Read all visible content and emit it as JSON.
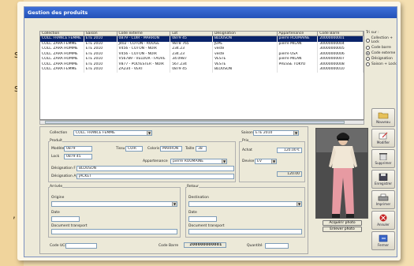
{
  "window": {
    "title": "Gestion des produits"
  },
  "list": {
    "columns": [
      "Collection",
      "Saison",
      "Code externe",
      "Lot",
      "Désignation",
      "Appartenance",
      "Code Barre"
    ],
    "rows": [
      [
        "COLL. FRANCE FEMME",
        "ETE 2010",
        "0879 - CUIR - MARRON",
        "0879 45",
        "BLOUSON",
        "pierre ROUMAINE",
        "20000000001"
      ],
      [
        "COLL. ZARA FEMME",
        "ETE 2010",
        "J402 - COTON - ROUGE",
        "9878 765",
        "JUPE",
        "pierre MILAN",
        "30000000004"
      ],
      [
        "COLL. ZARA HOMME",
        "ETE 2010",
        "V456 - COTON - NOIR",
        "234.23",
        "veste",
        "",
        "30000000005"
      ],
      [
        "COLL. ZARA HOMME",
        "ETE 2010",
        "V456 - COTON - NOIR",
        "234.23",
        "veste",
        "pierre USA",
        "30000000006"
      ],
      [
        "COLL. ZARA HOMME",
        "ETE 2010",
        "V56789 - VELOUR - FAUVE",
        "34.0987",
        "VESTE",
        "pierre MILAN",
        "30000000007"
      ],
      [
        "COLL. ZARA HOMME",
        "ETE 2010",
        "V877 - POLYESTER - NOIR",
        "567.234",
        "VESTE",
        "PRESSE TOKYO",
        "30000000008"
      ],
      [
        "COLL. ZARA FEMME",
        "ETE 2010",
        "ZA234 - VERT",
        "0879 45",
        "BLOUSON",
        "",
        "30000000010"
      ]
    ]
  },
  "sort": {
    "title": "Tri sur :",
    "options": [
      "Collection + Lock",
      "Code barre",
      "Code externe",
      "Désignation",
      "Saison + Lock"
    ],
    "selected_index": 2
  },
  "form": {
    "collection_label": "Collection",
    "collection_value": "COLL. FRANCE FEMME",
    "saison_label": "Saison",
    "saison_value": "ETE 2010",
    "produit_group": "Produit",
    "modele_label": "Modèle",
    "modele_value": "0879",
    "tissu_label": "Tissu",
    "tissu_value": "CUIR",
    "coloris_label": "Coloris",
    "coloris_value": "MARRON",
    "taille_label": "Taille",
    "taille_value": "38",
    "lock_label": "Lock",
    "lock_value": "0879 45",
    "appartenance_label": "Appartenance",
    "appartenance_value": "pierre ROUMAINE",
    "designation_f_label": "Désignation F",
    "designation_f_value": "BLOUSON",
    "designation_a_label": "Désignation A",
    "designation_a_value": "JACKET",
    "prix_group": "Prix",
    "achat_label": "Achat",
    "achat_value": "120.00 €",
    "devise_label": "Devise",
    "devise_value": "EV",
    "prix_value2": "120.00",
    "arrivee_group": "Arrivée",
    "origine_label": "Origine",
    "date_label": "Date",
    "doc_transport_label": "Document transport",
    "retour_group": "Retour",
    "destination_label": "Destination",
    "date_retour_label": "Date",
    "doc_transport_retour_label": "Document transport",
    "code_ucd_label": "Code UCD",
    "code_barre_label": "Code Barre",
    "code_barre_value": "200000000001",
    "quantite_label": "Quantité"
  },
  "photo": {
    "acquire_label": "Acquérir photo",
    "delete_label": "Enlever photo"
  },
  "toolbar": {
    "buttons": [
      "Nouveau",
      "Modifier",
      "Supprimer",
      "Enregistrer",
      "Imprimer",
      "Annuler",
      "Fermer"
    ]
  },
  "colors": {
    "titlebar": "#2452b8",
    "selection": "#0a246a",
    "window_bg": "#ece9d8",
    "page_bg": "#f4dfb1"
  }
}
